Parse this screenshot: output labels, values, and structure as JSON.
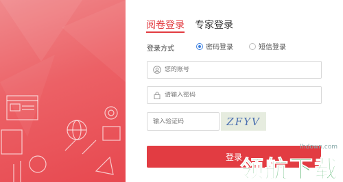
{
  "tabs": [
    {
      "label": "阅卷登录",
      "active": true
    },
    {
      "label": "专家登录",
      "active": false
    }
  ],
  "login_method": {
    "label": "登录方式",
    "options": [
      {
        "label": "密码登录",
        "checked": true
      },
      {
        "label": "短信登录",
        "checked": false
      }
    ]
  },
  "account": {
    "placeholder": "您的账号",
    "icon": "user-icon"
  },
  "password": {
    "placeholder": "请输入密码",
    "icon": "lock-icon"
  },
  "captcha": {
    "placeholder": "输入验证码",
    "code": "ZFYV"
  },
  "submit": {
    "label": "登录"
  },
  "watermark": {
    "site": "lhdown.com",
    "text": "领航下载"
  },
  "colors": {
    "accent": "#e23a3f",
    "panel": "#ec6166",
    "radio": "#3b7fe0"
  }
}
